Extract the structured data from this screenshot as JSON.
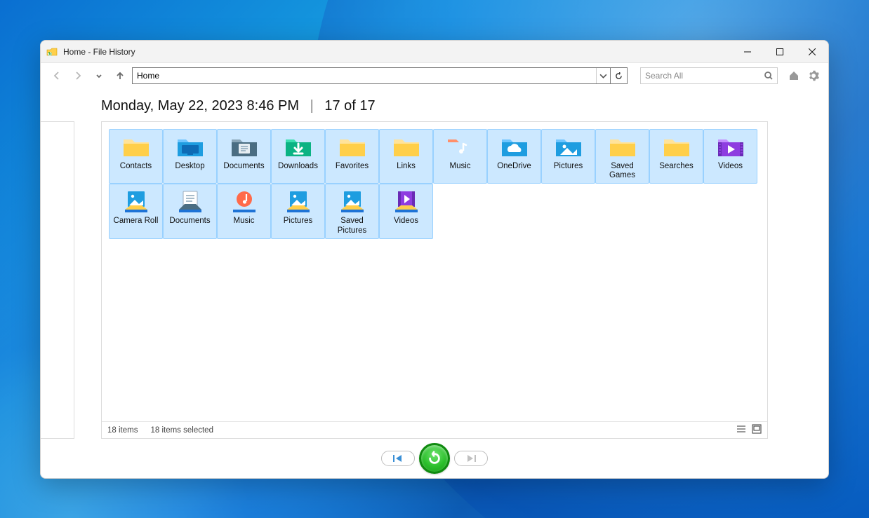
{
  "window": {
    "title": "Home - File History"
  },
  "nav": {
    "address": "Home"
  },
  "search": {
    "placeholder": "Search All"
  },
  "heading": {
    "timestamp": "Monday, May 22, 2023 8:46 PM",
    "counter": "17 of 17"
  },
  "status": {
    "count": "18 items",
    "selected": "18 items selected"
  },
  "items": [
    {
      "label": "Contacts",
      "icon": "folder"
    },
    {
      "label": "Desktop",
      "icon": "desktop"
    },
    {
      "label": "Documents",
      "icon": "documents"
    },
    {
      "label": "Downloads",
      "icon": "downloads"
    },
    {
      "label": "Favorites",
      "icon": "folder"
    },
    {
      "label": "Links",
      "icon": "folder"
    },
    {
      "label": "Music",
      "icon": "music"
    },
    {
      "label": "OneDrive",
      "icon": "onedrive"
    },
    {
      "label": "Pictures",
      "icon": "pictures"
    },
    {
      "label": "Saved Games",
      "icon": "folder"
    },
    {
      "label": "Searches",
      "icon": "folder"
    },
    {
      "label": "Videos",
      "icon": "videos"
    },
    {
      "label": "Camera Roll",
      "icon": "lib-pictures"
    },
    {
      "label": "Documents",
      "icon": "lib-documents"
    },
    {
      "label": "Music",
      "icon": "lib-music"
    },
    {
      "label": "Pictures",
      "icon": "lib-pictures"
    },
    {
      "label": "Saved Pictures",
      "icon": "lib-pictures"
    },
    {
      "label": "Videos",
      "icon": "lib-videos"
    }
  ]
}
